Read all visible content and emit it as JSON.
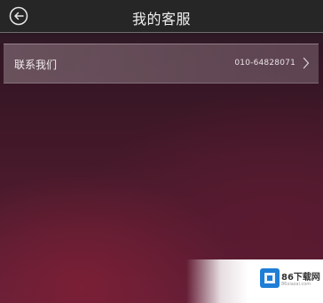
{
  "header": {
    "title": "我的客服",
    "back_icon": "back-arrow-circle-icon"
  },
  "contact": {
    "label": "联系我们",
    "phone": "010-64828071",
    "chevron_icon": "chevron-right-icon"
  },
  "watermark": {
    "text": "86下载网",
    "url": "86xiazai.com"
  },
  "colors": {
    "header_bg": "#262626",
    "row_bg": "#75626c",
    "background_top": "#2a1420",
    "background_bottom": "#62203a"
  }
}
